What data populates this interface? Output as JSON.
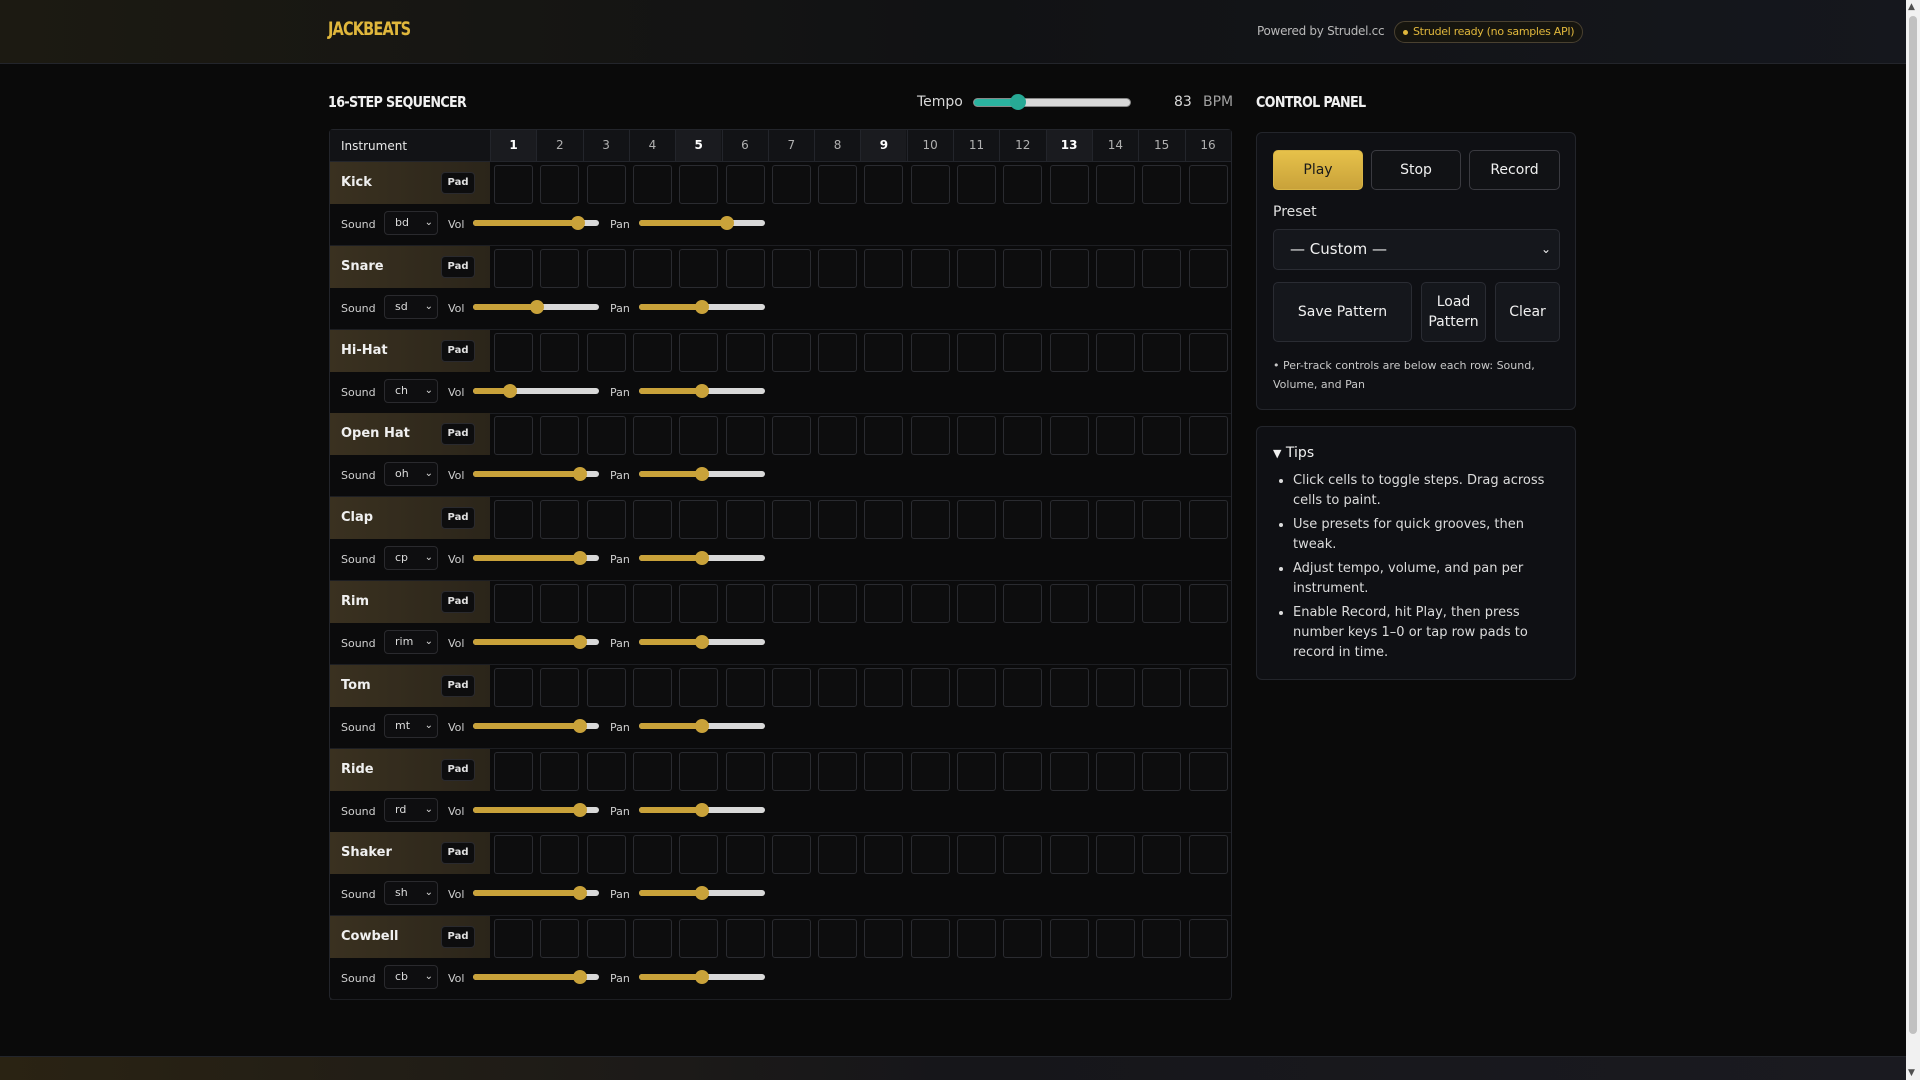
{
  "header": {
    "logo": "JACKBEATS",
    "powered": "Powered by Strudel.cc",
    "status": "Strudel ready (no samples API)",
    "accent": "#e0b73c"
  },
  "sequencer": {
    "title": "16-STEP SEQUENCER",
    "tempo_label": "Tempo",
    "tempo_value": "83",
    "tempo_unit": "BPM",
    "tempo_fraction": 0.28,
    "instrument_header": "Instrument",
    "steps": [
      "1",
      "2",
      "3",
      "4",
      "5",
      "6",
      "7",
      "8",
      "9",
      "10",
      "11",
      "12",
      "13",
      "14",
      "15",
      "16"
    ],
    "beat_steps": [
      1,
      5,
      9,
      13
    ],
    "sound_label": "Sound",
    "vol_label": "Vol",
    "pan_label": "Pan",
    "pad_label": "Pad",
    "rows": [
      {
        "name": "Kick",
        "sound": "bd",
        "vol": 0.83,
        "pan": 0.7
      },
      {
        "name": "Snare",
        "sound": "sd",
        "vol": 0.51,
        "pan": 0.5
      },
      {
        "name": "Hi-Hat",
        "sound": "ch",
        "vol": 0.29,
        "pan": 0.5
      },
      {
        "name": "Open Hat",
        "sound": "oh",
        "vol": 0.85,
        "pan": 0.5
      },
      {
        "name": "Clap",
        "sound": "cp",
        "vol": 0.85,
        "pan": 0.5
      },
      {
        "name": "Rim",
        "sound": "rim",
        "vol": 0.85,
        "pan": 0.5
      },
      {
        "name": "Tom",
        "sound": "mt",
        "vol": 0.85,
        "pan": 0.5
      },
      {
        "name": "Ride",
        "sound": "rd",
        "vol": 0.85,
        "pan": 0.5
      },
      {
        "name": "Shaker",
        "sound": "sh",
        "vol": 0.85,
        "pan": 0.5
      },
      {
        "name": "Cowbell",
        "sound": "cb",
        "vol": 0.85,
        "pan": 0.5
      }
    ]
  },
  "control_panel": {
    "title": "CONTROL PANEL",
    "play": "Play",
    "stop": "Stop",
    "record": "Record",
    "preset_label": "Preset",
    "preset_value": "— Custom —",
    "save": "Save Pattern",
    "load": "Load Pattern",
    "clear": "Clear",
    "note": "• Per-track controls are below each row: Sound, Volume, and Pan"
  },
  "tips": {
    "heading": "Tips",
    "items": [
      "Click cells to toggle steps. Drag across cells to paint.",
      "Use presets for quick grooves, then tweak.",
      "Adjust tempo, volume, and pan per instrument.",
      "Enable Record, hit Play, then press number keys 1–0 or tap row pads to record in time."
    ]
  },
  "icons": {
    "status": "status-dot-icon",
    "dropdown": "chevron-down-icon",
    "tips_toggle": "triangle-down-icon"
  }
}
